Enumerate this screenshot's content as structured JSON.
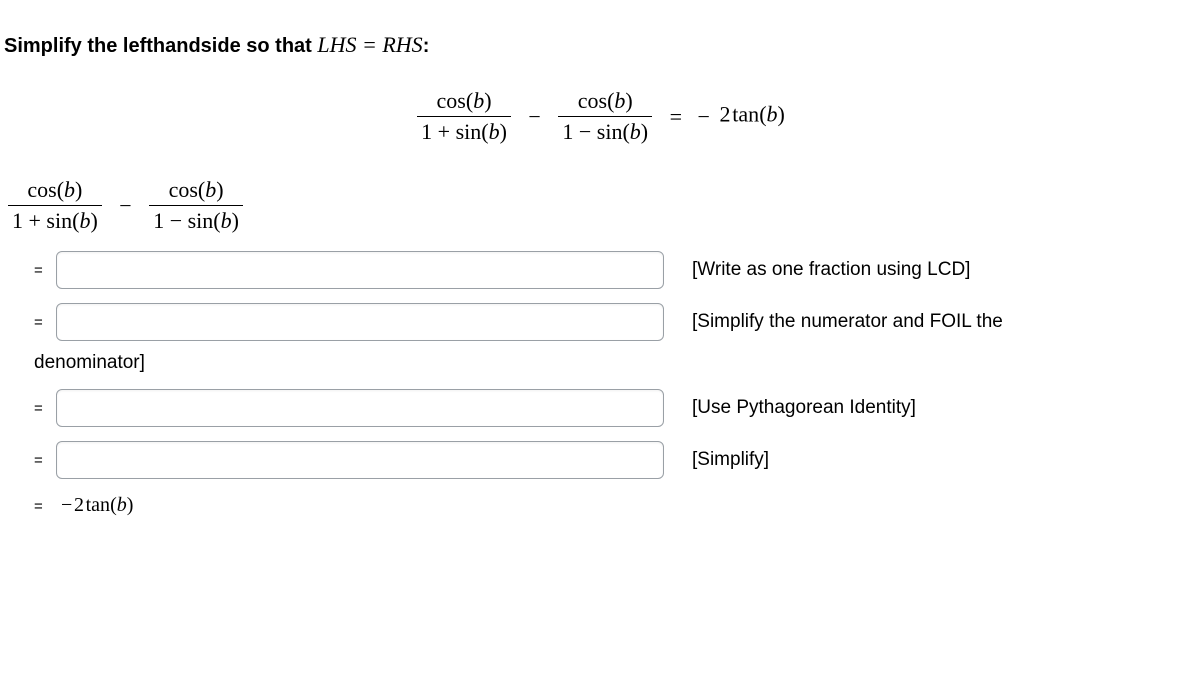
{
  "heading": {
    "prefix": "Simplify the lefthandside so that ",
    "lhs": "LHS",
    "eq": " = ",
    "rhs": "RHS",
    "suffix": ":"
  },
  "main_eq": {
    "frac1_num": "cos(b)",
    "frac1_den": "1 + sin(b)",
    "minus": "−",
    "frac2_num": "cos(b)",
    "frac2_den": "1 − sin(b)",
    "equals": "=",
    "rhs_neg": "−",
    "rhs_coef": "2",
    "rhs_fn": "tan",
    "rhs_arg": "(b)"
  },
  "lhs_start": {
    "frac1_num": "cos(b)",
    "frac1_den": "1 + sin(b)",
    "minus": "−",
    "frac2_num": "cos(b)",
    "frac2_den": "1 − sin(b)"
  },
  "steps": [
    {
      "eq": "=",
      "hint": "[Write as one fraction using LCD]",
      "hint_cont": ""
    },
    {
      "eq": "=",
      "hint": "[Simplify the numerator and FOIL the",
      "hint_cont": "denominator]"
    },
    {
      "eq": "=",
      "hint": "[Use Pythagorean Identity]",
      "hint_cont": ""
    },
    {
      "eq": "=",
      "hint": "[Simplify]",
      "hint_cont": ""
    }
  ],
  "final": {
    "eq": "=",
    "neg": "−",
    "coef": "2",
    "fn": "tan",
    "arg": "(b)"
  }
}
